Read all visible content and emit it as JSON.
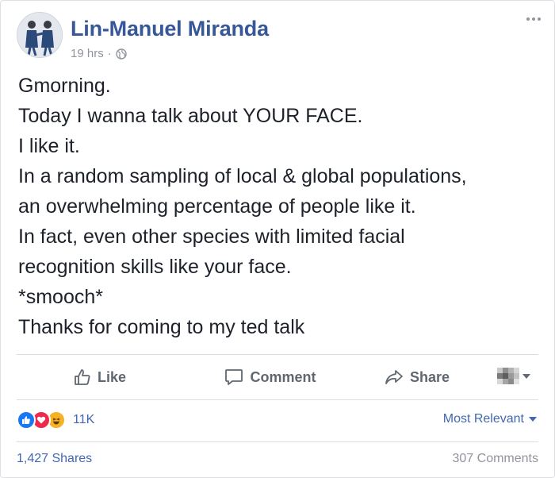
{
  "post": {
    "author": "Lin-Manuel Miranda",
    "time": "19 hrs",
    "separator": "·",
    "privacy_icon": "globe-icon",
    "lines": [
      "Gmorning.",
      "Today I wanna talk about YOUR FACE.",
      "I like it.",
      "In a random sampling of local & global populations,",
      "an overwhelming percentage of people like it.",
      "In fact, even other species with limited facial",
      "recognition skills like your face.",
      "*smooch*",
      "Thanks for coming to my ted talk"
    ]
  },
  "actions": {
    "like": "Like",
    "comment": "Comment",
    "share": "Share"
  },
  "reactions": {
    "icons": [
      "like-reaction-icon",
      "love-reaction-icon",
      "haha-reaction-icon"
    ],
    "count": "11K",
    "sort_label": "Most Relevant"
  },
  "footer": {
    "shares": "1,427 Shares",
    "comments": "307 Comments"
  },
  "colors": {
    "author_link": "#365899",
    "link": "#4267b2",
    "muted": "#90949c",
    "like_blue": "#1877f2",
    "love_red": "#f0284a",
    "haha_yellow": "#f7b125"
  }
}
